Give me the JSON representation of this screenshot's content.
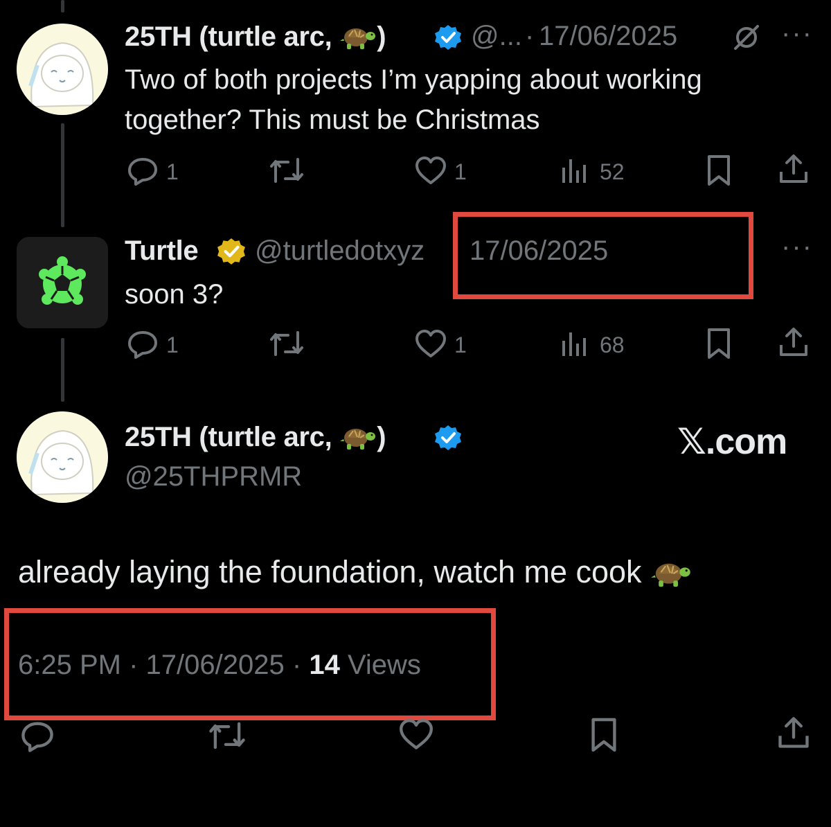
{
  "tweet1": {
    "author_name": "25TH (turtle arc,",
    "author_name_close": ")",
    "handle": "@...",
    "separator": "·",
    "date": "17/06/2025",
    "text_line1": "Two of both projects I’m yapping about working",
    "text_line2": "together? This must be Christmas",
    "replies": "1",
    "likes": "1",
    "views": "52"
  },
  "tweet2": {
    "author_name": "Turtle",
    "handle": "@turtledotxyz",
    "date": "17/06/2025",
    "text": "soon 3?",
    "replies": "1",
    "likes": "1",
    "views": "68"
  },
  "main_tweet": {
    "author_name": "25TH (turtle arc,",
    "author_name_close": ")",
    "handle": "@25THPRMR",
    "text": "already laying the foundation, watch me cook",
    "time": "6:25 PM",
    "sep1": "·",
    "date": "17/06/2025",
    "sep2": "·",
    "views_count": "14",
    "views_label": "Views"
  },
  "watermark": "𝕏.com",
  "more_glyph": "···",
  "icons": [
    "reply-icon",
    "retweet-icon",
    "like-icon",
    "views-icon",
    "bookmark-icon",
    "share-icon",
    "verified-blue-icon",
    "verified-gold-icon",
    "grok-icon",
    "turtle-emoji-icon"
  ],
  "colors": {
    "background": "#000000",
    "text": "#e7e9ea",
    "muted": "#71767b",
    "verified_blue": "#1d9bf0",
    "verified_gold": "#e2b719",
    "highlight_red": "#e0493e",
    "turtle_green": "#5ee85e"
  }
}
